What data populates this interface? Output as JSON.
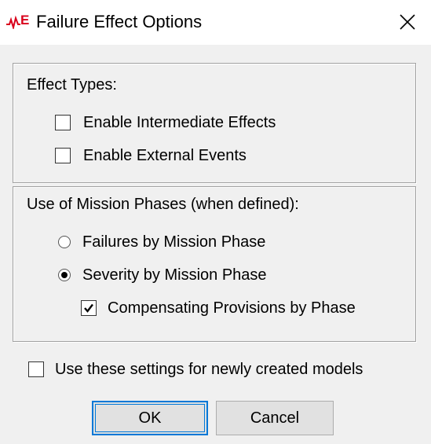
{
  "window": {
    "title": "Failure Effect Options",
    "app_icon": "relex-app-icon",
    "close_icon": "close-icon"
  },
  "effect_types": {
    "heading": "Effect Types:",
    "options": [
      {
        "label": "Enable Intermediate Effects",
        "checked": false
      },
      {
        "label": "Enable External Events",
        "checked": false
      }
    ]
  },
  "mission_phases": {
    "heading": "Use of Mission Phases (when defined):",
    "radios": [
      {
        "label": "Failures by Mission Phase",
        "selected": false
      },
      {
        "label": "Severity by Mission Phase",
        "selected": true
      }
    ],
    "sub_option": {
      "label": "Compensating Provisions by Phase",
      "checked": true
    }
  },
  "defaults_option": {
    "label": "Use these settings for newly created models",
    "checked": false
  },
  "buttons": {
    "ok": "OK",
    "cancel": "Cancel"
  },
  "colors": {
    "accent": "#0078d7",
    "icon_red": "#d9001b",
    "background": "#f0f0f0"
  }
}
